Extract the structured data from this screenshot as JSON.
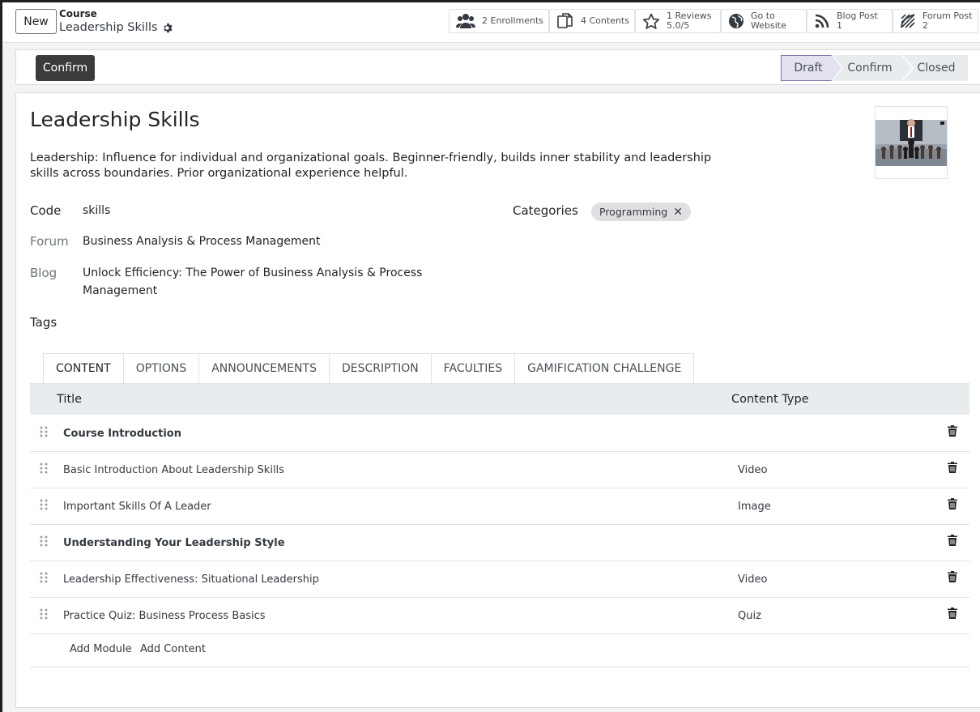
{
  "control_panel": {
    "new_label": "New",
    "breadcrumb_model": "Course",
    "breadcrumb_record": "Leadership Skills",
    "stat_buttons": [
      {
        "icon": "users-icon",
        "label": "2 Enrollments"
      },
      {
        "icon": "copy-icon",
        "label": "4 Contents"
      },
      {
        "icon": "star-icon",
        "line1": "1 Reviews",
        "line2": "5.0/5"
      },
      {
        "icon": "globe-icon",
        "line1": "Go to",
        "line2": "Website"
      },
      {
        "icon": "rss-icon",
        "line1": "Blog Post",
        "line2": "1"
      },
      {
        "icon": "forum-icon",
        "line1": "Forum Post",
        "line2": "2"
      }
    ]
  },
  "statusbar": {
    "confirm_label": "Confirm",
    "stages": [
      "Draft",
      "Confirm",
      "Closed"
    ],
    "active_stage": "Draft"
  },
  "form": {
    "name": "Leadership Skills",
    "description": "Leadership: Influence for individual and organizational goals. Beginner-friendly, builds inner stability and leadership skills across boundaries. Prior organizational experience helpful.",
    "code_label": "Code",
    "code_value": "skills",
    "forum_label": "Forum",
    "forum_value": "Business Analysis & Process Management",
    "blog_label": "Blog",
    "blog_value": "Unlock Efficiency: The Power of Business Analysis & Process Management",
    "tags_label": "Tags",
    "categories_label": "Categories",
    "category_tags": [
      "Programming"
    ]
  },
  "tabs": [
    "CONTENT",
    "OPTIONS",
    "ANNOUNCEMENTS",
    "DESCRIPTION",
    "FACULTIES",
    "GAMIFICATION CHALLENGE"
  ],
  "content_table": {
    "headers": {
      "title": "Title",
      "type": "Content Type"
    },
    "rows": [
      {
        "title": "Course Introduction",
        "type": "",
        "section": true
      },
      {
        "title": "Basic Introduction About Leadership Skills",
        "type": "Video",
        "section": false
      },
      {
        "title": "Important Skills Of A Leader",
        "type": "Image",
        "section": false
      },
      {
        "title": "Understanding Your Leadership Style",
        "type": "",
        "section": true
      },
      {
        "title": "Leadership Effectiveness: Situational Leadership",
        "type": "Video",
        "section": false
      },
      {
        "title": "Practice Quiz: Business Process Basics",
        "type": "Quiz",
        "section": false
      }
    ],
    "add_module": "Add Module",
    "add_content": "Add Content"
  },
  "colors": {
    "primary_dark": "#3b3b3b",
    "active_stage_bg": "#e4e1f0",
    "header_bg": "#e9ecef"
  }
}
